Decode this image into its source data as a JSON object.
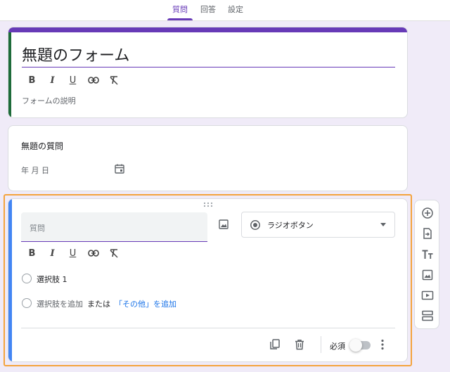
{
  "tabs": [
    {
      "label": "質問",
      "active": true
    },
    {
      "label": "回答",
      "active": false
    },
    {
      "label": "設定",
      "active": false
    }
  ],
  "header_card": {
    "title": "無題のフォーム",
    "format_buttons": [
      "B",
      "I",
      "U"
    ],
    "description_placeholder": "フォームの説明"
  },
  "date_question": {
    "title": "無題の質問",
    "date_placeholder": "年 月 日"
  },
  "active_question": {
    "question_placeholder": "質問",
    "type_label": "ラジオボタン",
    "format_buttons": [
      "B",
      "I",
      "U"
    ],
    "option_1": "選択肢 1",
    "add_option": "選択肢を追加",
    "or_text": "または",
    "add_other": "「その他」を追加",
    "required_label": "必須",
    "required_on": false
  },
  "colors": {
    "accent": "#673ab7",
    "selected_outline": "#f4a33c",
    "active_stripe": "#4285f4",
    "header_side_stripe": "#1e6b3a"
  }
}
